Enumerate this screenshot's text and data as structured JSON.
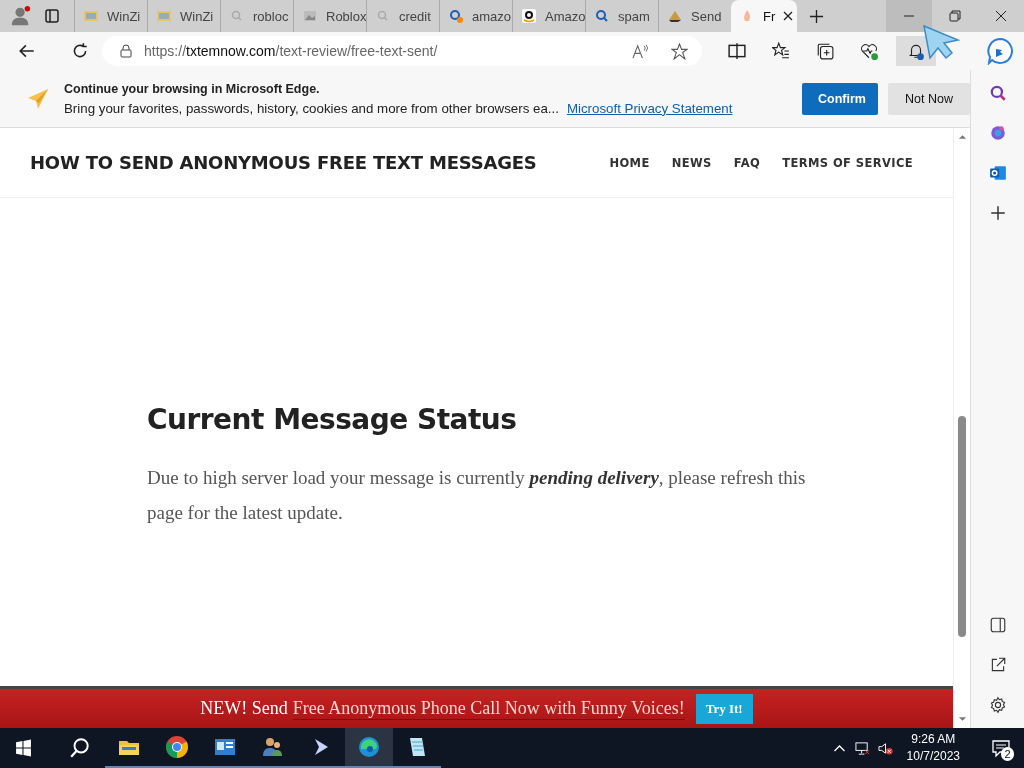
{
  "tabs": [
    {
      "title": "WinZi",
      "kind": "archive",
      "selected": false
    },
    {
      "title": "WinZi",
      "kind": "archive",
      "selected": false
    },
    {
      "title": "robloc",
      "kind": "search",
      "selected": false
    },
    {
      "title": "Roblox",
      "kind": "page",
      "selected": false
    },
    {
      "title": "credit",
      "kind": "search",
      "selected": false
    },
    {
      "title": "amazo",
      "kind": "search-badge",
      "selected": false
    },
    {
      "title": "Amazo",
      "kind": "amazon",
      "selected": false
    },
    {
      "title": "spam",
      "kind": "search-blue",
      "selected": false
    },
    {
      "title": "Send",
      "kind": "send",
      "selected": false
    },
    {
      "title": "Fr",
      "kind": "flame",
      "selected": true
    }
  ],
  "address_bar": {
    "scheme": "https://",
    "host": "txtemnow.com",
    "path": "/text-review/free-text-sent/"
  },
  "edge_banner": {
    "title": "Continue your browsing in Microsoft Edge.",
    "text": "Bring your favorites, passwords, history, cookies and more from other browsers ea...",
    "link": "Microsoft Privacy Statement",
    "buttons": [
      {
        "label": "Confirm",
        "kind": "primary"
      },
      {
        "label": "Not Now",
        "kind": "secondary"
      }
    ]
  },
  "site": {
    "title": "HOW TO SEND ANONYMOUS FREE TEXT MESSAGES",
    "nav": [
      "HOME",
      "NEWS",
      "FAQ",
      "TERMS OF SERVICE"
    ]
  },
  "main": {
    "heading": "Current Message Status",
    "paragraph": "Due to high server load your message is currently **pending delivery**, please refresh this page for the latest update."
  },
  "promo": {
    "lead": "NEW! Send",
    "link": "Free Anonymous Phone Call Now with Funny Voices!",
    "button": "Try It!"
  },
  "taskbar": {
    "apps": [
      {
        "kind": "files",
        "selected": false
      },
      {
        "kind": "chrome",
        "selected": false
      },
      {
        "kind": "control",
        "selected": false
      },
      {
        "kind": "users",
        "selected": false
      },
      {
        "kind": "cursor",
        "selected": false
      },
      {
        "kind": "edge",
        "selected": true
      },
      {
        "kind": "notepad",
        "selected": false
      }
    ],
    "time": "9:26 AM",
    "date": "10/7/2023",
    "notifications": "2"
  }
}
